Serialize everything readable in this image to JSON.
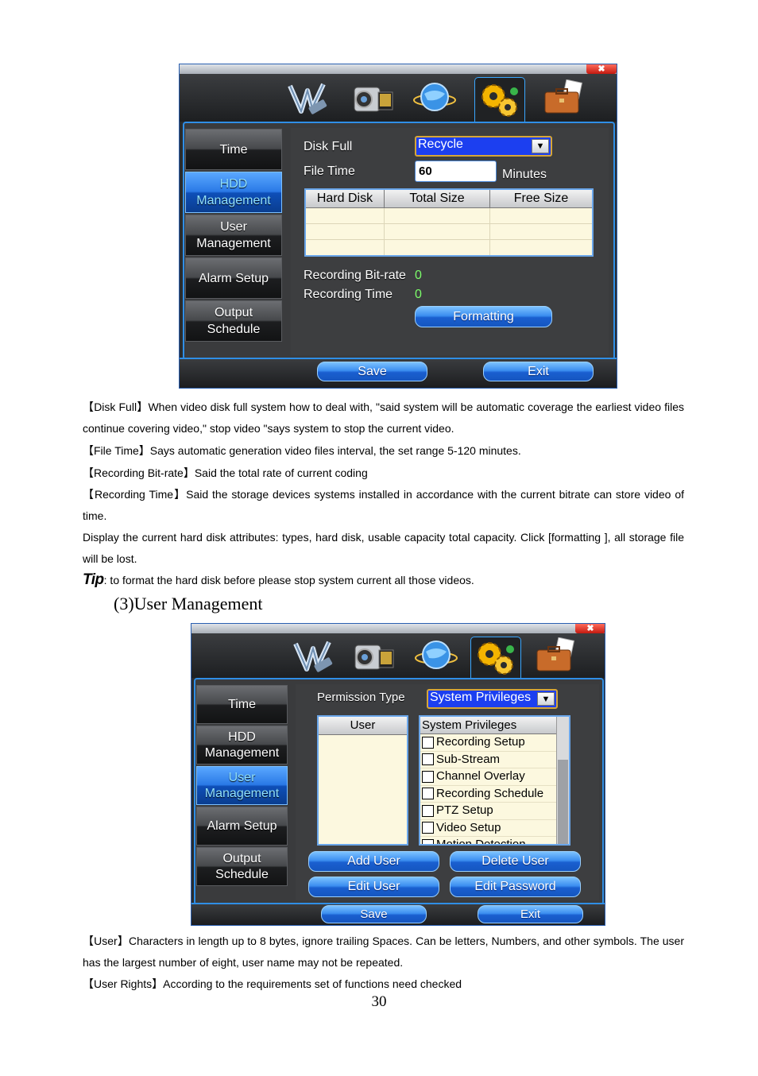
{
  "screen1": {
    "close_label": "✖",
    "tabs": [
      {
        "icon": "wand-icon",
        "active": false
      },
      {
        "icon": "camcorder-icon",
        "active": false
      },
      {
        "icon": "globe-icon",
        "active": false
      },
      {
        "icon": "gears-icon",
        "active": true
      },
      {
        "icon": "briefcase-icon",
        "active": false
      }
    ],
    "menu": [
      {
        "label": "Time",
        "selected": false
      },
      {
        "label": "HDD\nManagement",
        "selected": true
      },
      {
        "label": "User\nManagement",
        "selected": false
      },
      {
        "label": "Alarm Setup",
        "selected": false
      },
      {
        "label": "Output\nSchedule",
        "selected": false
      }
    ],
    "disk_full_label": "Disk Full",
    "disk_full_value": "Recycle",
    "file_time_label": "File Time",
    "file_time_value": "60",
    "file_time_unit": "Minutes",
    "table_headers": [
      "Hard Disk",
      "Total Size",
      "Free Size"
    ],
    "bitrate_label": "Recording Bit-rate",
    "bitrate_value": "0",
    "rec_time_label": "Recording Time",
    "rec_time_value": "0",
    "formatting_label": "Formatting",
    "save_label": "Save",
    "exit_label": "Exit"
  },
  "text": {
    "p1_tag": "【Disk Full】",
    "p1": "When video disk full system how to deal with, \"said system will be automatic coverage the earliest video files continue covering video,\" stop video \"says system to stop the current video.",
    "p2_tag": "【File Time】",
    "p2": "Says automatic generation video files interval, the set range 5-120 minutes.",
    "p3_tag": "【Recording Bit-rate】",
    "p3": "Said the total rate of current coding",
    "p4_tag": "【Recording Time】",
    "p4": "Said the storage devices systems installed in accordance with the current bitrate can store video of time.",
    "p5": "Display the current hard disk attributes: types, hard disk, usable capacity total capacity. Click [formatting ], all storage file will be lost.",
    "tip_label": "Tip",
    "tip_text": ": to format the hard disk before please stop system current all those videos.",
    "heading": "(3)User Management",
    "p6_tag": "【User】",
    "p6": "Characters in length up to 8 bytes, ignore trailing Spaces. Can be letters, Numbers, and other symbols. The user has the largest number of eight, user name may not be repeated.",
    "p7_tag": "【User Rights】",
    "p7": "According to the requirements set of functions need checked",
    "page_number": "30"
  },
  "screen2": {
    "close_label": "✖",
    "menu": [
      {
        "label": "Time",
        "selected": false
      },
      {
        "label": "HDD\nManagement",
        "selected": false
      },
      {
        "label": "User\nManagement",
        "selected": true
      },
      {
        "label": "Alarm Setup",
        "selected": false
      },
      {
        "label": "Output\nSchedule",
        "selected": false
      }
    ],
    "permission_label": "Permission Type",
    "permission_value": "System Privileges",
    "user_header": "User",
    "priv_header": "System Privileges",
    "privileges": [
      "Recording Setup",
      "Sub-Stream",
      "Channel Overlay",
      "Recording Schedule",
      "PTZ Setup",
      "Video Setup",
      "Motion Detection"
    ],
    "add_user_label": "Add User",
    "delete_user_label": "Delete User",
    "edit_user_label": "Edit User",
    "edit_password_label": "Edit Password",
    "save_label": "Save",
    "exit_label": "Exit"
  }
}
